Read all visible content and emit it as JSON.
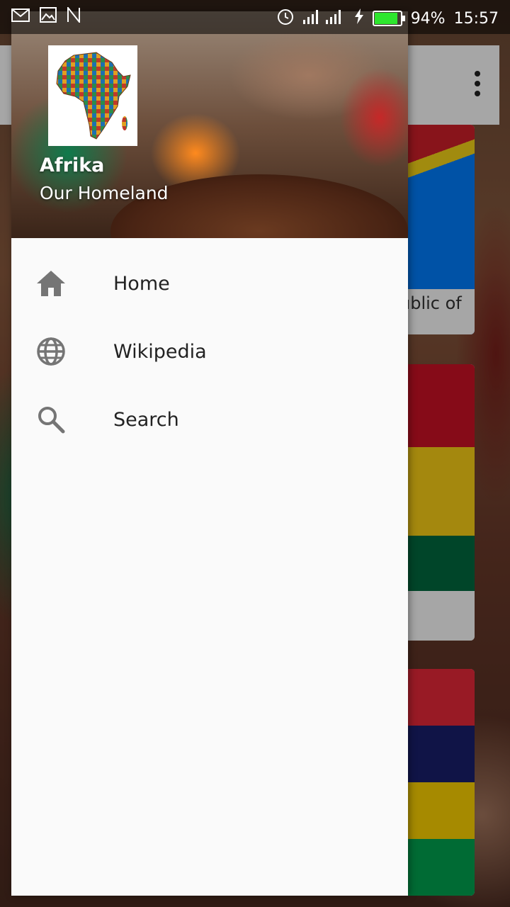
{
  "status_bar": {
    "notification_icons": [
      "gmail-icon",
      "image-icon",
      "nfc-icon"
    ],
    "battery_percent": "94%",
    "battery_level": 0.94,
    "time": "15:57"
  },
  "app": {
    "card_caption": "ublic of"
  },
  "drawer": {
    "header": {
      "title": "Afrika",
      "subtitle": "Our Homeland"
    },
    "items": [
      {
        "label": "Home",
        "icon": "home-icon"
      },
      {
        "label": "Wikipedia",
        "icon": "globe-icon"
      },
      {
        "label": "Search",
        "icon": "search-icon"
      }
    ]
  },
  "colors": {
    "icon_grey": "#757575",
    "drawer_bg": "#fafafa",
    "battery_green": "#2ee62e"
  }
}
